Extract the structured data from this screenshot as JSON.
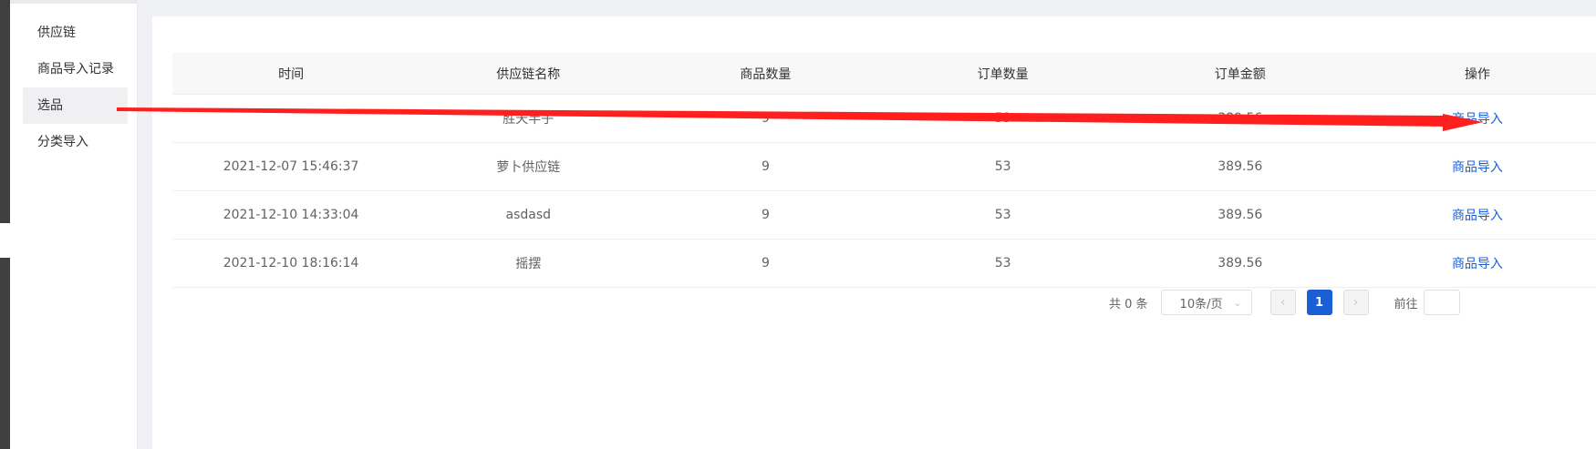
{
  "sidebar": {
    "items": [
      {
        "label": "供应链"
      },
      {
        "label": "商品导入记录"
      },
      {
        "label": "选品"
      },
      {
        "label": "分类导入"
      }
    ]
  },
  "table": {
    "headers": [
      "时间",
      "供应链名称",
      "商品数量",
      "订单数量",
      "订单金额",
      "操作"
    ],
    "rows": [
      {
        "time": "",
        "name": "胜天半子",
        "goods": "9",
        "orders": "53",
        "amount": "389.56",
        "action": "商品导入"
      },
      {
        "time": "2021-12-07 15:46:37",
        "name": "萝卜供应链",
        "goods": "9",
        "orders": "53",
        "amount": "389.56",
        "action": "商品导入"
      },
      {
        "time": "2021-12-10 14:33:04",
        "name": "asdasd",
        "goods": "9",
        "orders": "53",
        "amount": "389.56",
        "action": "商品导入"
      },
      {
        "time": "2021-12-10 18:16:14",
        "name": "摇摆",
        "goods": "9",
        "orders": "53",
        "amount": "389.56",
        "action": "商品导入"
      }
    ]
  },
  "pagination": {
    "total_text": "共 0 条",
    "page_size": "10条/页",
    "current_page": "1",
    "goto_label": "前往"
  },
  "colors": {
    "accent": "#1a5fd6",
    "annotation_arrow": "#ff1f1f"
  },
  "icons": {
    "select_arrow": "chevron-down-icon",
    "prev": "chevron-left-icon",
    "next": "chevron-right-icon"
  }
}
